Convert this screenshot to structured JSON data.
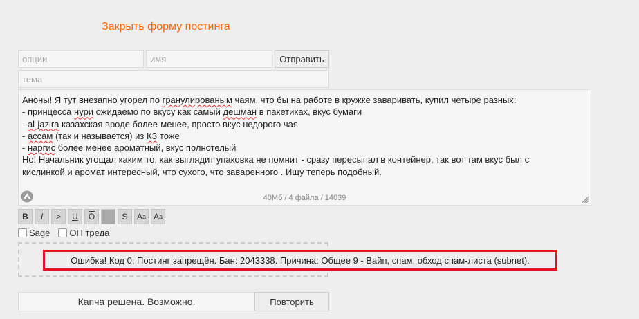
{
  "form": {
    "close_label": "Закрыть форму постинга",
    "options_placeholder": "опции",
    "name_placeholder": "имя",
    "submit_label": "Отправить",
    "subject_placeholder": "тема",
    "comment_lines": [
      [
        {
          "t": "Аноны! Я тут внезапно угорел по "
        },
        {
          "t": "гранулированым",
          "spell": true
        },
        {
          "t": " чаям, что бы на работе в кружке заваривать, купил четыре разных:"
        }
      ],
      [
        {
          "t": "- принцесса "
        },
        {
          "t": "нури",
          "spell": true
        },
        {
          "t": " ожидаемо по вкусу как самый "
        },
        {
          "t": "дешман",
          "spell": true
        },
        {
          "t": " в пакетиках, вкус бумаги"
        }
      ],
      [
        {
          "t": "- "
        },
        {
          "t": "al-jazira",
          "spell": true
        },
        {
          "t": " казахская вроде более-менее, просто вкус недорого чая"
        }
      ],
      [
        {
          "t": "- "
        },
        {
          "t": "ассам",
          "spell": true
        },
        {
          "t": " (так и называется) из "
        },
        {
          "t": "КЗ",
          "spell": true
        },
        {
          "t": " тоже"
        }
      ],
      [
        {
          "t": "- "
        },
        {
          "t": "наргис",
          "spell": true
        },
        {
          "t": " более менее ароматный, вкус полнотелый"
        }
      ],
      [
        {
          "t": "Но! Начальник угощал каким то, как выглядит упаковка не помнит - сразу пересыпал в контейнер, так вот там вкус был с"
        }
      ],
      [
        {
          "t": "кислинкой и аромат интересный, что сухого, что заваренного . Ищу теперь подобный."
        }
      ]
    ],
    "file_counter": "40Мб / 4 файла / 14039",
    "markup_buttons": [
      {
        "label": "B",
        "name": "bold-button",
        "style": "font-weight:bold"
      },
      {
        "label": "I",
        "name": "italic-button",
        "style": "font-style:italic"
      },
      {
        "label": ">",
        "name": "quote-button",
        "style": ""
      },
      {
        "label": "U",
        "name": "underline-button",
        "style": "text-decoration:underline"
      },
      {
        "label": "O",
        "name": "overline-button",
        "style": "text-decoration:overline"
      },
      {
        "label": "",
        "name": "spoiler-button",
        "style": "background:#aaaaaa"
      },
      {
        "label": "S",
        "name": "strike-button",
        "style": "text-decoration:line-through"
      },
      {
        "label": "Aa",
        "name": "superscript-button",
        "sup": true
      },
      {
        "label": "Aa",
        "name": "subscript-button",
        "sub": true
      }
    ],
    "sage_label": "Sage",
    "op_label": "ОП треда",
    "error_text": "Ошибка! Код 0, Постинг запрещён. Бан: 2043338. Причина: Общее 9 - Вайп, спам, обход спам-листа (subnet).",
    "captcha_status": "Капча решена. Возможно.",
    "retry_label": "Повторить",
    "accent_color": "#ff6600",
    "error_border_color": "#e0141e"
  }
}
